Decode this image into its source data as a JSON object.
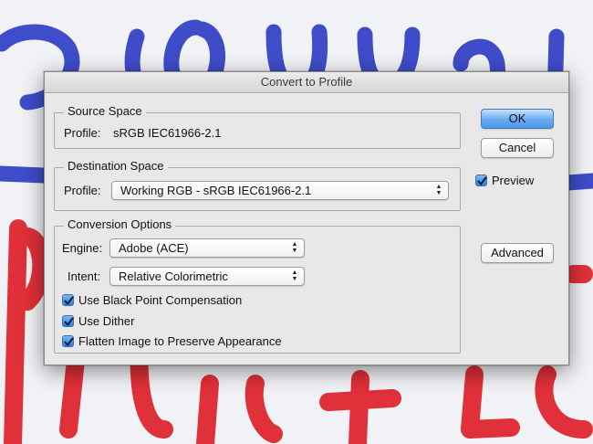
{
  "dialog": {
    "title": "Convert to Profile",
    "source": {
      "title": "Source Space",
      "profile_label": "Profile:",
      "profile_value": "sRGB IEC61966-2.1"
    },
    "destination": {
      "title": "Destination Space",
      "profile_label": "Profile:",
      "profile_value": "Working RGB - sRGB IEC61966-2.1"
    },
    "conversion": {
      "title": "Conversion Options",
      "engine_label": "Engine:",
      "engine_value": "Adobe (ACE)",
      "intent_label": "Intent:",
      "intent_value": "Relative Colorimetric",
      "black_point": {
        "label": "Use Black Point Compensation",
        "checked": true
      },
      "dither": {
        "label": "Use Dither",
        "checked": true
      },
      "flatten": {
        "label": "Flatten Image to Preserve Appearance",
        "checked": true
      }
    },
    "buttons": {
      "ok": "OK",
      "cancel": "Cancel",
      "advanced": "Advanced"
    },
    "preview": {
      "label": "Preview",
      "checked": true
    }
  },
  "colors": {
    "paint_blue": "#2f3fc6",
    "paint_red": "#e0242e",
    "default_button": "#5fa2ef"
  }
}
